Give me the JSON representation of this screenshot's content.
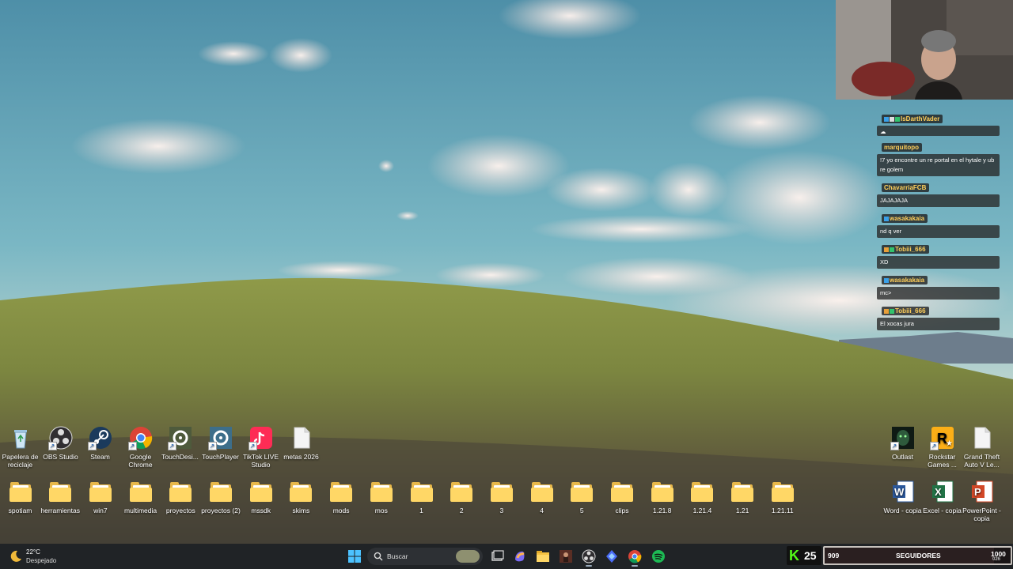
{
  "desktop": {
    "row1": [
      {
        "label": "Papelera de reciclaje",
        "icon": "recycle-bin-icon"
      },
      {
        "label": "OBS Studio",
        "icon": "obs-icon"
      },
      {
        "label": "Steam",
        "icon": "steam-icon"
      },
      {
        "label": "Google Chrome",
        "icon": "chrome-icon"
      },
      {
        "label": "TouchDesi...",
        "icon": "touchdesigner-icon"
      },
      {
        "label": "TouchPlayer",
        "icon": "touchplayer-icon"
      },
      {
        "label": "TikTok LIVE Studio",
        "icon": "tiktok-icon"
      },
      {
        "label": "metas 2026",
        "icon": "text-file-icon"
      }
    ],
    "row2": [
      {
        "label": "spotiam",
        "icon": "folder-icon"
      },
      {
        "label": "herramientas",
        "icon": "folder-icon"
      },
      {
        "label": "win7",
        "icon": "folder-icon"
      },
      {
        "label": "multimedia",
        "icon": "folder-icon"
      },
      {
        "label": "proyectos",
        "icon": "folder-icon"
      },
      {
        "label": "proyectos (2)",
        "icon": "folder-icon"
      },
      {
        "label": "mssdk",
        "icon": "folder-icon"
      },
      {
        "label": "skims",
        "icon": "folder-icon"
      },
      {
        "label": "mods",
        "icon": "folder-icon"
      },
      {
        "label": "mos",
        "icon": "folder-icon"
      },
      {
        "label": "1",
        "icon": "folder-icon"
      },
      {
        "label": "2",
        "icon": "folder-icon"
      },
      {
        "label": "3",
        "icon": "folder-icon"
      },
      {
        "label": "4",
        "icon": "folder-icon"
      },
      {
        "label": "5",
        "icon": "folder-icon"
      },
      {
        "label": "clips",
        "icon": "folder-icon"
      },
      {
        "label": "1.21.8",
        "icon": "folder-icon"
      },
      {
        "label": "1.21.4",
        "icon": "folder-icon"
      },
      {
        "label": "1.21",
        "icon": "folder-icon"
      },
      {
        "label": "1.21.11",
        "icon": "folder-icon"
      }
    ],
    "right_row1": [
      {
        "label": "Outlast",
        "icon": "outlast-icon"
      },
      {
        "label": "Rockstar Games ...",
        "icon": "rockstar-icon"
      },
      {
        "label": "Grand Theft Auto V Le...",
        "icon": "text-file-icon"
      }
    ],
    "right_row2": [
      {
        "label": "Word - copia",
        "icon": "word-icon"
      },
      {
        "label": "Excel - copia",
        "icon": "excel-icon"
      },
      {
        "label": "PowerPoint - copia",
        "icon": "powerpoint-icon"
      }
    ]
  },
  "chat": [
    {
      "user": "IsDarthVader",
      "text": "",
      "user_color": "#ffcf5a"
    },
    {
      "user": "marquitopo",
      "text": "!7 yo encontre un re portal en el hytale y ub re golem",
      "user_color": "#ffcf5a"
    },
    {
      "user": "ChavarriaFCB",
      "text": "JAJAJAJA",
      "user_color": "#ffcf5a"
    },
    {
      "user": "wasakakaia",
      "text": "nd q ver",
      "user_color": "#ffcf5a"
    },
    {
      "user": "Tobiii_666",
      "text": "XD",
      "user_color": "#ffcf5a"
    },
    {
      "user": "wasakakaia",
      "text": "mc>",
      "user_color": "#ffcf5a"
    },
    {
      "user": "Tobiii_666",
      "text": "El xocas jura",
      "user_color": "#ffcf5a"
    }
  ],
  "weather": {
    "temp": "22°C",
    "condition": "Despejado"
  },
  "taskbar": {
    "search_placeholder": "Buscar"
  },
  "kick": {
    "letter": "K",
    "count": "25"
  },
  "followers": {
    "current": "909",
    "label": "SEGUIDORES",
    "goal": "1000",
    "sub": "026",
    "fraction": 0.909
  },
  "colors": {
    "taskbar": "#202326",
    "folder": "#ffd766",
    "accent": "#53fc18"
  }
}
